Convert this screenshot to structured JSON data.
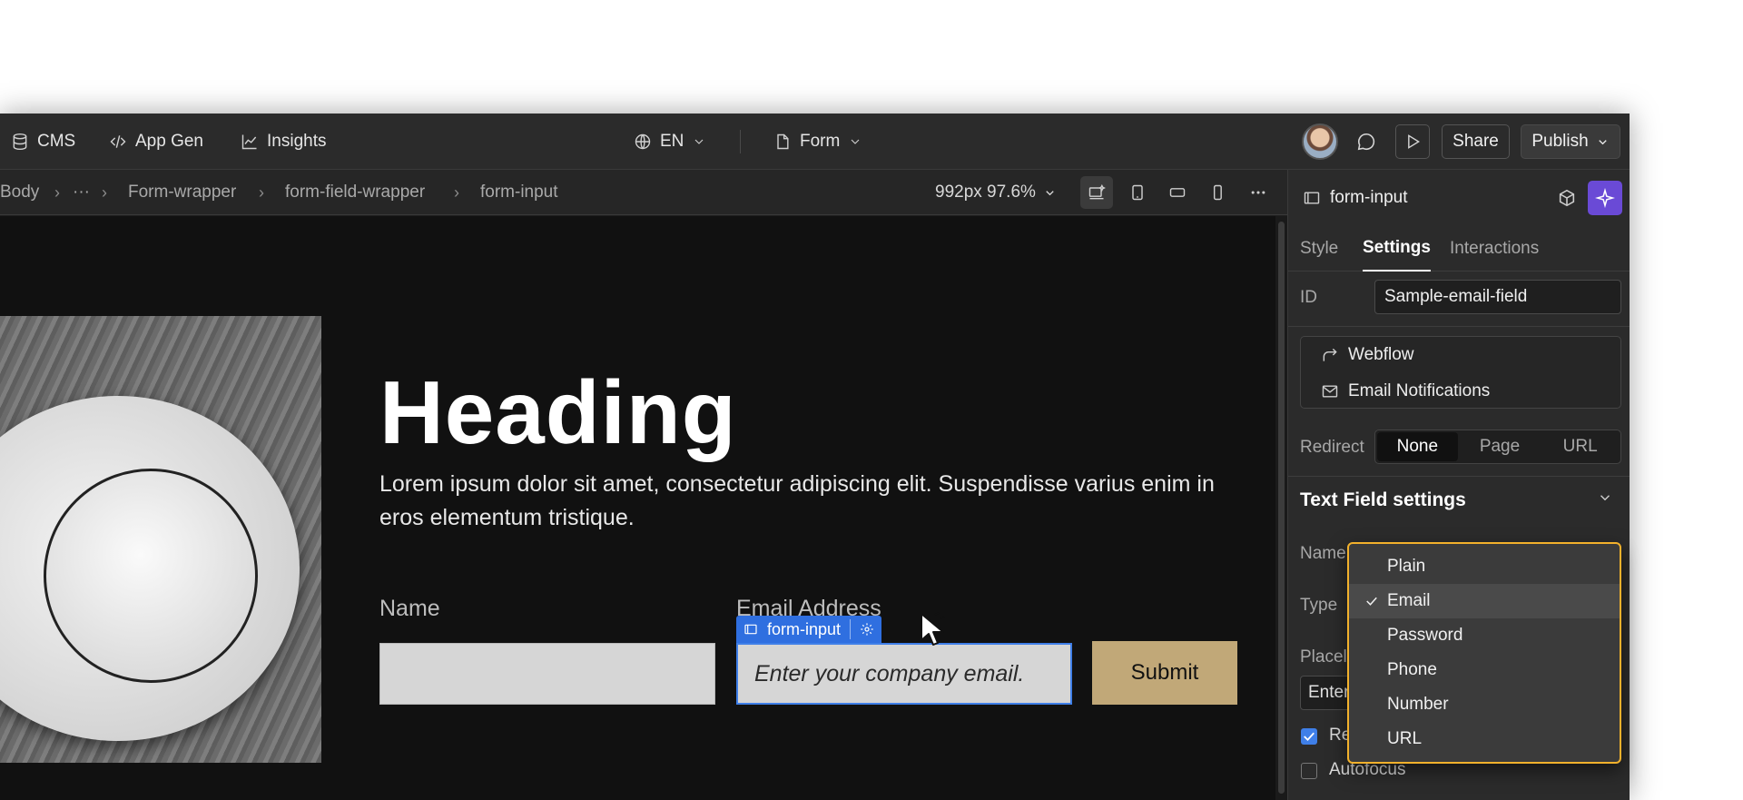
{
  "topbar": {
    "cms": "CMS",
    "app_gen": "App Gen",
    "insights": "Insights",
    "locale": "EN",
    "page": "Form",
    "share": "Share",
    "publish": "Publish"
  },
  "breadcrumb": {
    "items": [
      "Body",
      "···",
      "Form-wrapper",
      "form-field-wrapper",
      "form-input"
    ]
  },
  "viewport": {
    "label": "992px 97.6%"
  },
  "canvas": {
    "heading": "Heading",
    "lead": "Lorem ipsum dolor sit amet, consectetur adipiscing elit. Suspendisse varius enim in eros elementum tristique.",
    "name_label": "Name",
    "email_label": "Email Address",
    "email_placeholder": "Enter your company email.",
    "submit": "Submit",
    "selection_tag": "form-input"
  },
  "panel": {
    "element_name": "form-input",
    "tabs": [
      "Style",
      "Settings",
      "Interactions"
    ],
    "active_tab": "Settings",
    "id_label": "ID",
    "id_value": "Sample-email-field",
    "actions": [
      "Webflow",
      "Email Notifications"
    ],
    "redirect_label": "Redirect",
    "redirect_options": [
      "None",
      "Page",
      "URL"
    ],
    "redirect_selected": "None",
    "section_title": "Text Field settings",
    "name_label": "Name",
    "type_label": "Type",
    "placeholder_label": "Placel",
    "placeholder_value": "Enter",
    "required_label": "Re",
    "required_checked": true,
    "autofocus_label": "Autofocus",
    "autofocus_checked": false
  },
  "type_dropdown": {
    "options": [
      "Plain",
      "Email",
      "Password",
      "Phone",
      "Number",
      "URL"
    ],
    "selected": "Email"
  },
  "colors": {
    "accent_blue": "#3f7fe8",
    "dropdown_border": "#f2b12c",
    "submit_bg": "#c1a878",
    "ai_button": "#6a4ad6"
  }
}
